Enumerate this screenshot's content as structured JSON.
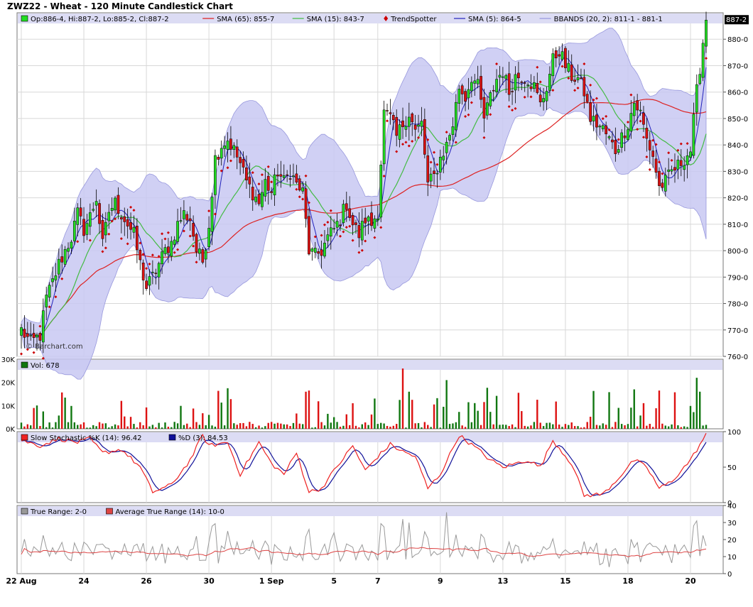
{
  "title": "ZWZ22 - Wheat - 120 Minute Candlestick Chart",
  "watermark": "© Barchart.com",
  "colors": {
    "up": "#22dd22",
    "down": "#dd1111",
    "sma65": "#dd2222",
    "sma15": "#44bb44",
    "sma5": "#2222bb",
    "trend": "#cc0000",
    "band_fill": "#c8c8f2",
    "band_line": "#9898dd",
    "legend_bg": "#dcdcf4",
    "grid": "#d8d8d8",
    "frame": "#777777",
    "stoch_k": "#ee2222",
    "stoch_d": "#111199",
    "tr": "#999999",
    "atr": "#dd4444",
    "vol_up": "#117711",
    "vol_down": "#dd1111"
  },
  "legends": {
    "price": [
      {
        "label": "Op:886-4, Hi:887-2, Lo:885-2, Cl:887-2",
        "swatch": "box-green"
      },
      {
        "label": "SMA (65): 855-7",
        "swatch": "line-red"
      },
      {
        "label": "SMA (15): 843-7",
        "swatch": "line-green"
      },
      {
        "label": "TrendSpotter",
        "swatch": "diamond-red"
      },
      {
        "label": "SMA (5): 864-5",
        "swatch": "line-blue"
      },
      {
        "label": "BBANDS (20, 2): 811-1 - 881-1",
        "swatch": "line-band"
      }
    ],
    "volume": [
      {
        "label": "Vol: 678",
        "swatch": "box-darkgreen"
      }
    ],
    "stoch": [
      {
        "label": "Slow Stochastic %K (14): 96.42",
        "swatch": "box-red"
      },
      {
        "label": "%D (3): 84.53",
        "swatch": "box-navy"
      }
    ],
    "atr": [
      {
        "label": "True Range: 2-0",
        "swatch": "box-gray"
      },
      {
        "label": "Average True Range (14): 10-0",
        "swatch": "box-pink"
      }
    ]
  },
  "last_price_tag": "887-2",
  "x_ticks": [
    {
      "label": "22 Aug",
      "i": 0
    },
    {
      "label": "24",
      "i": 20
    },
    {
      "label": "26",
      "i": 40
    },
    {
      "label": "30",
      "i": 60
    },
    {
      "label": "1 Sep",
      "i": 80
    },
    {
      "label": "5",
      "i": 100
    },
    {
      "label": "7",
      "i": 114
    },
    {
      "label": "9",
      "i": 134
    },
    {
      "label": "13",
      "i": 154
    },
    {
      "label": "15",
      "i": 174
    },
    {
      "label": "18",
      "i": 194
    },
    {
      "label": "20",
      "i": 214
    }
  ],
  "chart_data": {
    "type": "candlestick",
    "symbol": "ZWZ22",
    "interval": "120 Minute",
    "price_axis": {
      "min": 760,
      "max": 890,
      "ticks": [
        "760-0",
        "770-0",
        "780-0",
        "790-0",
        "800-0",
        "810-0",
        "820-0",
        "830-0",
        "840-0",
        "850-0",
        "860-0",
        "870-0",
        "880-0"
      ]
    },
    "volume_axis": {
      "min": 0,
      "max": 30000,
      "ticks": [
        "0K",
        "10K",
        "20K",
        "30K"
      ]
    },
    "stoch_axis": {
      "min": 0,
      "max": 100,
      "ticks": [
        "0",
        "50",
        "100"
      ]
    },
    "atr_axis": {
      "min": 0,
      "max": 40,
      "ticks": [
        "0",
        "10",
        "20",
        "30",
        "40"
      ]
    },
    "close_anchors": [
      [
        0,
        770
      ],
      [
        3,
        765
      ],
      [
        6,
        768
      ],
      [
        8,
        782
      ],
      [
        10,
        788
      ],
      [
        12,
        795
      ],
      [
        14,
        800
      ],
      [
        16,
        805
      ],
      [
        18,
        814
      ],
      [
        20,
        808
      ],
      [
        22,
        813
      ],
      [
        24,
        820
      ],
      [
        26,
        802
      ],
      [
        28,
        815
      ],
      [
        30,
        818
      ],
      [
        32,
        814
      ],
      [
        34,
        810
      ],
      [
        36,
        806
      ],
      [
        38,
        795
      ],
      [
        40,
        786
      ],
      [
        42,
        790
      ],
      [
        44,
        795
      ],
      [
        46,
        800
      ],
      [
        48,
        803
      ],
      [
        50,
        810
      ],
      [
        52,
        814
      ],
      [
        54,
        812
      ],
      [
        56,
        800
      ],
      [
        58,
        796
      ],
      [
        60,
        810
      ],
      [
        62,
        835
      ],
      [
        64,
        840
      ],
      [
        66,
        842
      ],
      [
        68,
        838
      ],
      [
        70,
        833
      ],
      [
        72,
        826
      ],
      [
        74,
        822
      ],
      [
        76,
        818
      ],
      [
        78,
        826
      ],
      [
        80,
        822
      ],
      [
        82,
        830
      ],
      [
        84,
        826
      ],
      [
        86,
        830
      ],
      [
        88,
        825
      ],
      [
        90,
        822
      ],
      [
        92,
        800
      ],
      [
        94,
        798
      ],
      [
        96,
        800
      ],
      [
        98,
        805
      ],
      [
        100,
        808
      ],
      [
        102,
        812
      ],
      [
        104,
        818
      ],
      [
        106,
        810
      ],
      [
        108,
        806
      ],
      [
        110,
        812
      ],
      [
        112,
        810
      ],
      [
        114,
        815
      ],
      [
        116,
        852
      ],
      [
        118,
        850
      ],
      [
        120,
        843
      ],
      [
        122,
        848
      ],
      [
        124,
        852
      ],
      [
        126,
        845
      ],
      [
        128,
        848
      ],
      [
        130,
        825
      ],
      [
        132,
        828
      ],
      [
        134,
        835
      ],
      [
        136,
        840
      ],
      [
        138,
        848
      ],
      [
        140,
        862
      ],
      [
        142,
        858
      ],
      [
        144,
        866
      ],
      [
        146,
        862
      ],
      [
        148,
        850
      ],
      [
        150,
        858
      ],
      [
        152,
        865
      ],
      [
        154,
        868
      ],
      [
        156,
        860
      ],
      [
        158,
        866
      ],
      [
        160,
        866
      ],
      [
        162,
        865
      ],
      [
        164,
        862
      ],
      [
        166,
        855
      ],
      [
        168,
        862
      ],
      [
        170,
        872
      ],
      [
        172,
        876
      ],
      [
        174,
        870
      ],
      [
        176,
        866
      ],
      [
        178,
        865
      ],
      [
        180,
        860
      ],
      [
        182,
        850
      ],
      [
        184,
        848
      ],
      [
        186,
        846
      ],
      [
        188,
        842
      ],
      [
        190,
        838
      ],
      [
        192,
        843
      ],
      [
        194,
        848
      ],
      [
        196,
        856
      ],
      [
        198,
        852
      ],
      [
        200,
        842
      ],
      [
        202,
        836
      ],
      [
        204,
        824
      ],
      [
        206,
        826
      ],
      [
        208,
        830
      ],
      [
        210,
        832
      ],
      [
        212,
        835
      ],
      [
        214,
        838
      ],
      [
        216,
        860
      ],
      [
        218,
        879
      ],
      [
        219,
        887
      ]
    ],
    "stoch_k_anchors": [
      [
        0,
        88
      ],
      [
        6,
        80
      ],
      [
        12,
        90
      ],
      [
        18,
        85
      ],
      [
        22,
        90
      ],
      [
        26,
        70
      ],
      [
        32,
        75
      ],
      [
        38,
        50
      ],
      [
        42,
        15
      ],
      [
        48,
        25
      ],
      [
        54,
        60
      ],
      [
        58,
        95
      ],
      [
        60,
        80
      ],
      [
        66,
        85
      ],
      [
        70,
        40
      ],
      [
        76,
        85
      ],
      [
        80,
        55
      ],
      [
        84,
        40
      ],
      [
        88,
        70
      ],
      [
        92,
        15
      ],
      [
        96,
        20
      ],
      [
        100,
        45
      ],
      [
        106,
        80
      ],
      [
        110,
        45
      ],
      [
        114,
        65
      ],
      [
        118,
        82
      ],
      [
        122,
        72
      ],
      [
        126,
        65
      ],
      [
        130,
        20
      ],
      [
        134,
        40
      ],
      [
        140,
        95
      ],
      [
        146,
        75
      ],
      [
        150,
        60
      ],
      [
        154,
        50
      ],
      [
        158,
        55
      ],
      [
        162,
        60
      ],
      [
        166,
        50
      ],
      [
        170,
        88
      ],
      [
        176,
        55
      ],
      [
        180,
        10
      ],
      [
        186,
        12
      ],
      [
        190,
        30
      ],
      [
        196,
        60
      ],
      [
        200,
        50
      ],
      [
        204,
        20
      ],
      [
        208,
        30
      ],
      [
        214,
        60
      ],
      [
        219,
        96
      ]
    ],
    "volume_profile": "low baseline ~1-3K with spikes up to ~26K near Sep 7 and ~22K near Sep 20"
  }
}
